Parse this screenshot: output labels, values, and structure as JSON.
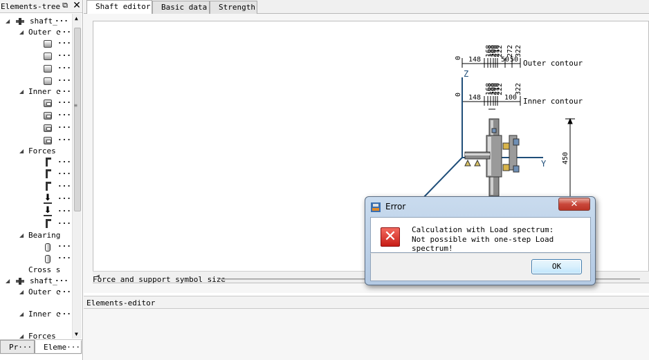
{
  "left_panel": {
    "title": "Elements-tree",
    "float_icon": "⧉",
    "close_icon": "✕",
    "scroll_up": "▲",
    "scroll_down": "▼",
    "scroll_grip": "≡",
    "tree": {
      "shaft1": {
        "label": "shaft_",
        "dots": "···",
        "toggle": "◢"
      },
      "outer1": {
        "label": "Outer c",
        "dots": "···",
        "toggle": "◢"
      },
      "outer1_items": [
        "···",
        "···",
        "···",
        "···"
      ],
      "inner1": {
        "label": "Inner c",
        "dots": "···",
        "toggle": "◢"
      },
      "inner1_items": [
        "···",
        "···",
        "···",
        "···"
      ],
      "forces1": {
        "label": "Forces",
        "toggle": "◢"
      },
      "forces1_items": [
        "···",
        "···",
        "···",
        "···",
        "···",
        "···"
      ],
      "bearing1": {
        "label": "Bearing",
        "toggle": "◢"
      },
      "bearing1_items": [
        "···",
        "···"
      ],
      "cross1": {
        "label": "Cross s"
      },
      "shaft2": {
        "label": "shaft_",
        "dots": "···",
        "toggle": "◢"
      },
      "outer2": {
        "label": "Outer c",
        "dots": "···",
        "toggle": "◢"
      },
      "inner2": {
        "label": "Inner c",
        "dots": "···",
        "toggle": "◢"
      },
      "forces2": {
        "label": "Forces",
        "toggle": "◢"
      }
    },
    "bottom_tabs": [
      {
        "label": "Pr···"
      },
      {
        "label": "Eleme···"
      }
    ]
  },
  "tabs": [
    {
      "label": "Shaft editor"
    },
    {
      "label": "Basic data"
    },
    {
      "label": "Strength"
    }
  ],
  "editor": {
    "scroll_left": "◀",
    "symbol_size_label": "Force and support symbol size"
  },
  "elements_editor": {
    "title": "Elements-editor"
  },
  "drawing": {
    "outer_contour_label": "Outer contour",
    "inner_contour_label": "Inner contour",
    "outer_dims": {
      "zero": "0",
      "first": "148",
      "cluster": [
        "168",
        "188",
        "200",
        "210",
        "222"
      ],
      "tail": [
        "272",
        "322"
      ],
      "small": [
        "50",
        "50"
      ]
    },
    "inner_dims": {
      "zero": "0",
      "first": "148",
      "cluster": [
        "168",
        "188",
        "200",
        "210",
        "222"
      ],
      "tail": [
        "322"
      ],
      "small": [
        "100"
      ]
    },
    "axis_z": "Z",
    "axis_y": "Y",
    "height_dim": "450",
    "accent_color": "#1f4e79"
  },
  "dialog": {
    "title": "Error",
    "close_symbol": "✕",
    "error_symbol": "✕",
    "message_line1": "Calculation with Load spectrum:",
    "message_line2": "Not possible with one-step Load spectrum!",
    "ok_label": "OK"
  }
}
